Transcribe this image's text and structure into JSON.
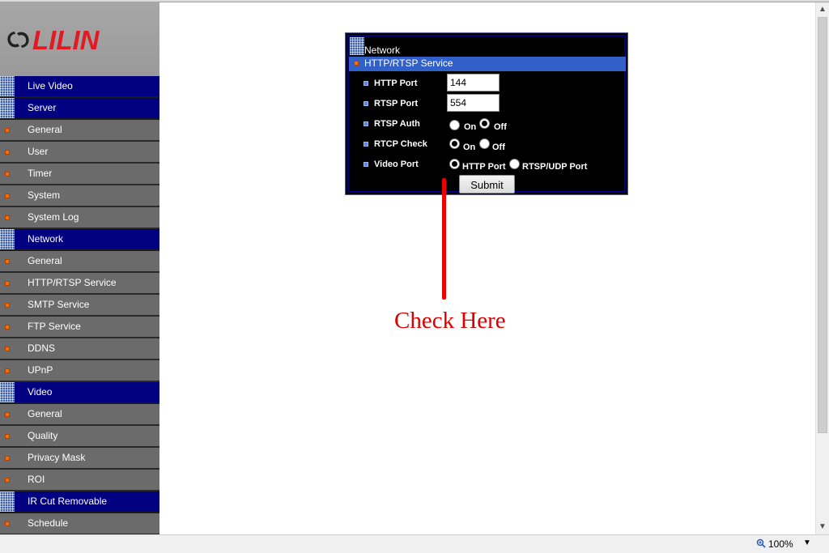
{
  "logo": {
    "text": "LILIN"
  },
  "sidebar": {
    "items": [
      {
        "type": "section",
        "label": "Live Video"
      },
      {
        "type": "section",
        "label": "Server"
      },
      {
        "type": "item",
        "label": "General"
      },
      {
        "type": "item",
        "label": "User"
      },
      {
        "type": "item",
        "label": "Timer"
      },
      {
        "type": "item",
        "label": "System"
      },
      {
        "type": "item",
        "label": "System Log"
      },
      {
        "type": "section",
        "label": "Network"
      },
      {
        "type": "item",
        "label": "General"
      },
      {
        "type": "item",
        "label": "HTTP/RTSP Service"
      },
      {
        "type": "item",
        "label": "SMTP Service"
      },
      {
        "type": "item",
        "label": "FTP Service"
      },
      {
        "type": "item",
        "label": "DDNS"
      },
      {
        "type": "item",
        "label": "UPnP"
      },
      {
        "type": "section",
        "label": "Video"
      },
      {
        "type": "item",
        "label": "General"
      },
      {
        "type": "item",
        "label": "Quality"
      },
      {
        "type": "item",
        "label": "Privacy Mask"
      },
      {
        "type": "item",
        "label": "ROI"
      },
      {
        "type": "section",
        "label": "IR Cut Removable"
      },
      {
        "type": "item",
        "label": "Schedule"
      }
    ]
  },
  "panel": {
    "title": "Network",
    "service": "HTTP/RTSP Service",
    "http_port": {
      "label": "HTTP Port",
      "value": "144"
    },
    "rtsp_port": {
      "label": "RTSP Port",
      "value": "554"
    },
    "rtsp_auth": {
      "label": "RTSP Auth",
      "on": "On",
      "off": "Off",
      "selected": "Off"
    },
    "rtcp_check": {
      "label": "RTCP Check",
      "on": "On",
      "off": "Off",
      "selected": "On"
    },
    "video_port": {
      "label": "Video Port",
      "opt1": "HTTP Port",
      "opt2": "RTSP/UDP Port",
      "selected": "HTTP Port"
    },
    "submit": "Submit"
  },
  "annotation": {
    "text": "Check Here",
    "color": "#dd0000"
  },
  "statusbar": {
    "zoom": "100%"
  },
  "colors": {
    "section_bg": "#000080",
    "item_bg": "#6b6b6b",
    "service_bar": "#3160c8",
    "bullet": "#f07010"
  }
}
